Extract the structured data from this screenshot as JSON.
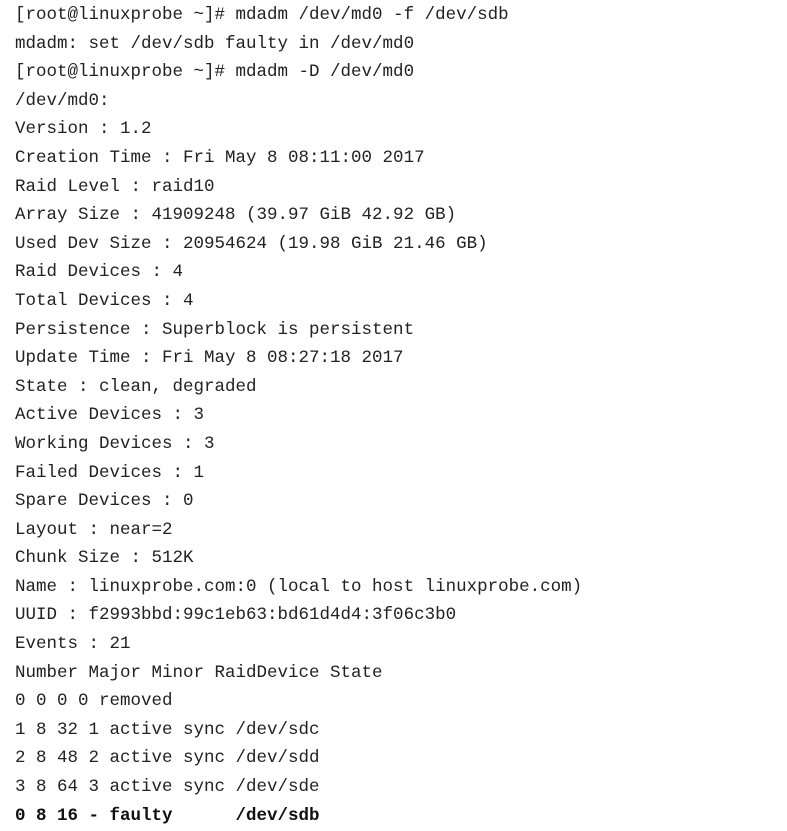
{
  "terminal": {
    "lines": [
      "[root@linuxprobe ~]# mdadm /dev/md0 -f /dev/sdb",
      "mdadm: set /dev/sdb faulty in /dev/md0",
      "[root@linuxprobe ~]# mdadm -D /dev/md0",
      "/dev/md0:",
      "Version : 1.2",
      "Creation Time : Fri May 8 08:11:00 2017",
      "Raid Level : raid10",
      "Array Size : 41909248 (39.97 GiB 42.92 GB)",
      "Used Dev Size : 20954624 (19.98 GiB 21.46 GB)",
      "Raid Devices : 4",
      "Total Devices : 4",
      "Persistence : Superblock is persistent",
      "Update Time : Fri May 8 08:27:18 2017",
      "State : clean, degraded",
      "Active Devices : 3",
      "Working Devices : 3",
      "Failed Devices : 1",
      "Spare Devices : 0",
      "Layout : near=2",
      "Chunk Size : 512K",
      "Name : linuxprobe.com:0 (local to host linuxprobe.com)",
      "UUID : f2993bbd:99c1eb63:bd61d4d4:3f06c3b0",
      "Events : 21",
      "Number Major Minor RaidDevice State",
      "0 0 0 0 removed",
      "1 8 32 1 active sync /dev/sdc",
      "2 8 48 2 active sync /dev/sdd",
      "3 8 64 3 active sync /dev/sde",
      "0 8 16 - faulty      /dev/sdb"
    ]
  }
}
